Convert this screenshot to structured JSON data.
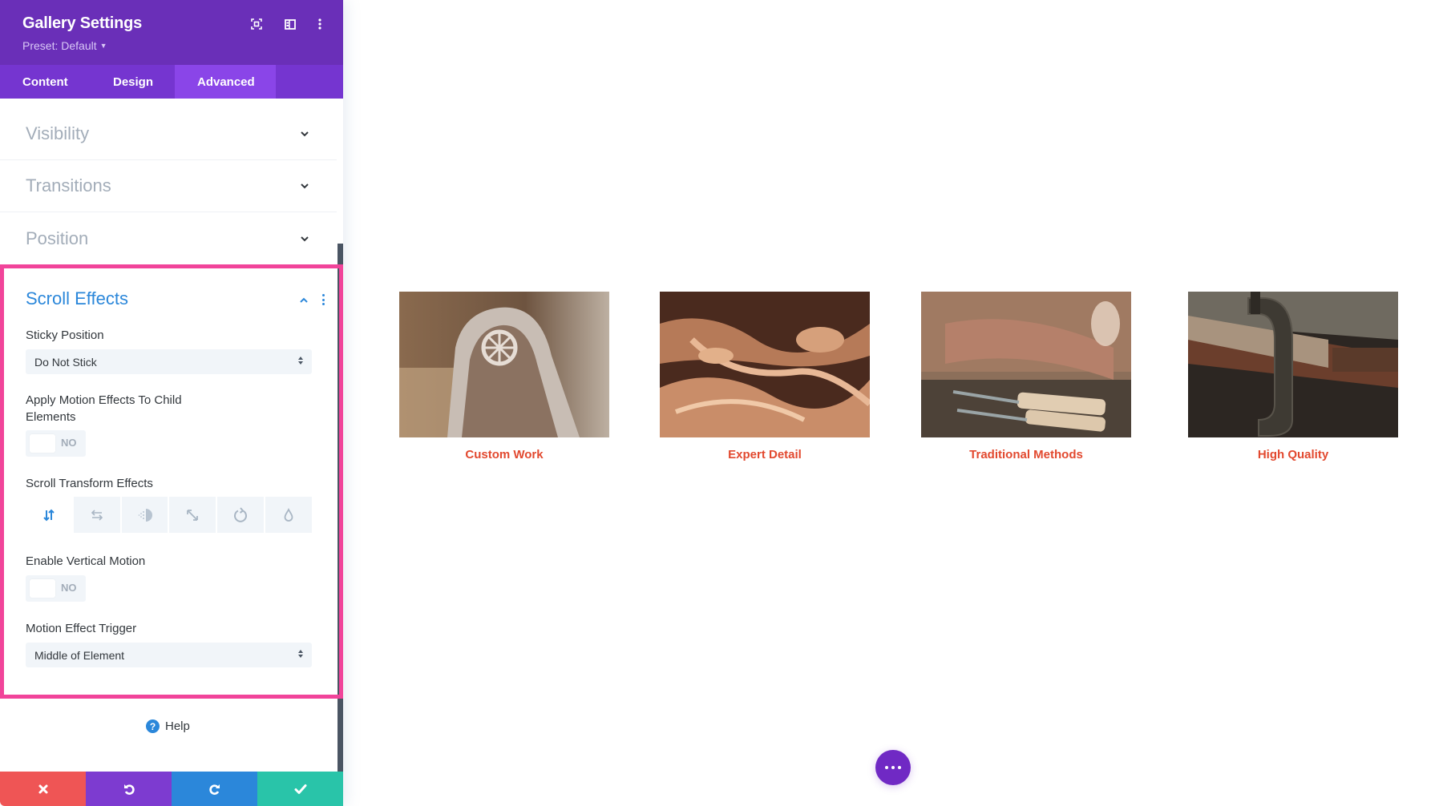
{
  "panel": {
    "title": "Gallery Settings",
    "preset_label": "Preset: Default",
    "header_icons": [
      "expand-icon",
      "split-view-icon",
      "more-options-icon"
    ],
    "tabs": [
      {
        "label": "Content",
        "active": false
      },
      {
        "label": "Design",
        "active": false
      },
      {
        "label": "Advanced",
        "active": true
      }
    ],
    "collapsed_sections": [
      {
        "label": "Visibility"
      },
      {
        "label": "Transitions"
      },
      {
        "label": "Position"
      }
    ],
    "scroll_effects": {
      "title": "Scroll Effects",
      "sticky_position": {
        "label": "Sticky Position",
        "value": "Do Not Stick"
      },
      "apply_child": {
        "label": "Apply Motion Effects To Child Elements",
        "label_line1": "Apply Motion Effects To Child",
        "label_line2": "Elements",
        "value": "NO"
      },
      "transform_effects": {
        "label": "Scroll Transform Effects",
        "options": [
          {
            "icon": "vertical-motion-icon",
            "active": true
          },
          {
            "icon": "horizontal-motion-icon",
            "active": false
          },
          {
            "icon": "fade-icon",
            "active": false
          },
          {
            "icon": "scale-icon",
            "active": false
          },
          {
            "icon": "rotate-icon",
            "active": false
          },
          {
            "icon": "blur-icon",
            "active": false
          }
        ]
      },
      "vertical_motion": {
        "label": "Enable Vertical Motion",
        "value": "NO"
      },
      "trigger": {
        "label": "Motion Effect Trigger",
        "value": "Middle of Element"
      }
    },
    "help_label": "Help",
    "footer_buttons": [
      "cancel",
      "undo",
      "redo",
      "save"
    ]
  },
  "gallery": {
    "items": [
      {
        "caption": "Custom Work"
      },
      {
        "caption": "Expert Detail"
      },
      {
        "caption": "Traditional Methods"
      },
      {
        "caption": "High Quality"
      }
    ]
  },
  "colors": {
    "header_purple": "#6a2fb8",
    "active_tab": "#8a45e8",
    "accent_blue": "#2b87da",
    "highlight_pink": "#f1449a",
    "caption_red": "#e2492f",
    "cancel_red": "#ef5555",
    "save_green": "#29c4a9"
  }
}
